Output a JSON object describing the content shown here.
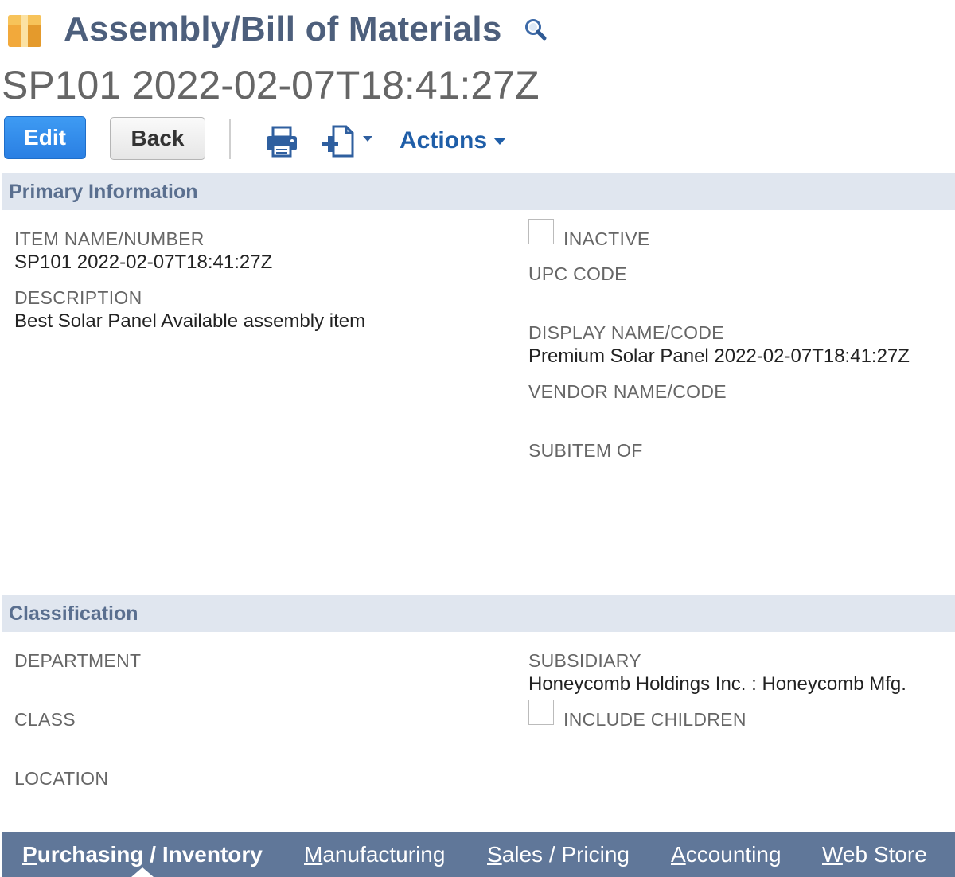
{
  "header": {
    "record_type": "Assembly/Bill of Materials",
    "record_title": "SP101 2022-02-07T18:41:27Z",
    "icons": {
      "item": "package-icon",
      "search": "search-icon"
    }
  },
  "toolbar": {
    "edit_label": "Edit",
    "back_label": "Back",
    "actions_label": "Actions",
    "icons": {
      "print": "print-icon",
      "new": "new-record-icon"
    }
  },
  "primary": {
    "title": "Primary Information",
    "item_name_label": "ITEM NAME/NUMBER",
    "item_name_value": "SP101 2022-02-07T18:41:27Z",
    "description_label": "DESCRIPTION",
    "description_value": "Best Solar Panel Available assembly item",
    "inactive_label": "INACTIVE",
    "inactive_checked": false,
    "upc_label": "UPC CODE",
    "display_name_label": "DISPLAY NAME/CODE",
    "display_name_value": "Premium Solar Panel 2022-02-07T18:41:27Z",
    "vendor_label": "VENDOR NAME/CODE",
    "subitem_label": "SUBITEM OF"
  },
  "classification": {
    "title": "Classification",
    "department_label": "DEPARTMENT",
    "class_label": "CLASS",
    "location_label": "LOCATION",
    "subsidiary_label": "SUBSIDIARY",
    "subsidiary_value": "Honeycomb Holdings Inc. : Honeycomb Mfg.",
    "include_children_label": "INCLUDE CHILDREN",
    "include_children_checked": false
  },
  "subtabs": {
    "purchasing": {
      "first": "P",
      "rest": "urchasing / Inventory"
    },
    "manufacturing": {
      "first": "M",
      "rest": "anufacturing"
    },
    "sales": {
      "first": "S",
      "rest": "ales / Pricing"
    },
    "accounting": {
      "first": "A",
      "rest": "ccounting"
    },
    "webstore": {
      "first": "W",
      "rest": "eb Store"
    },
    "active": "purchasing"
  },
  "colors": {
    "title_color": "#4d5f7c",
    "section_bg": "#e0e6ef",
    "subtab_bg": "#607799",
    "edit_button": "#2a7fe3",
    "link": "#1f5ea8"
  }
}
